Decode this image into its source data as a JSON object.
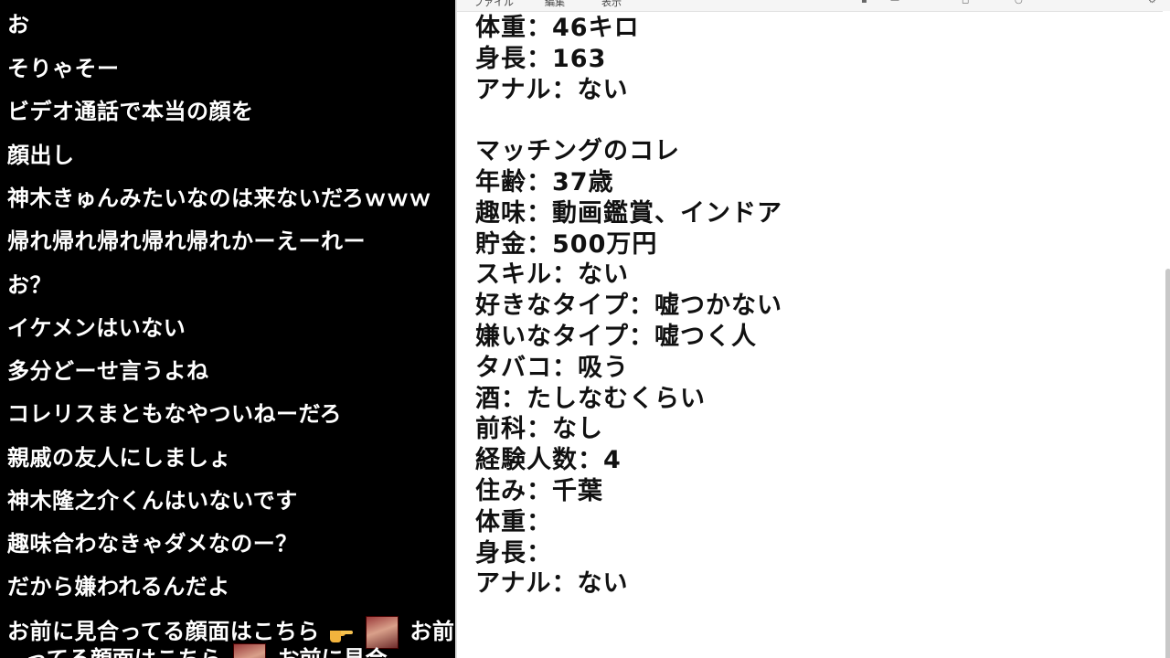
{
  "chat": {
    "messages": [
      "お",
      "そりゃそー",
      "ビデオ通話で本当の顔を",
      "顔出し",
      "神木きゅんみたいなのは来ないだろｗｗｗ",
      "帰れ帰れ帰れ帰れ帰れかーえーれー",
      "お？",
      "イケメンはいない",
      "多分どーせ言うよね",
      "コレリスまともなやついねーだろ",
      "親戚の友人にしましょ",
      "神木隆之介くんはいないです",
      "趣味合わなきゃダメなのー？",
      "だから嫌われるんだよ"
    ],
    "last_message_part1": "お前に見合ってる顔面はこちら",
    "last_message_part2": "お前に",
    "overflow_line": "ってる顔面はこちら",
    "overflow_line_tail": "お前に見合",
    "hand_icon": "pointing-hand-emoji",
    "face_icon": "face-image"
  },
  "notepad": {
    "menu": [
      "ファイル",
      "編集",
      "表示"
    ],
    "lines": [
      "体重：46キロ",
      "身長：163",
      "アナル：ない",
      "",
      "マッチングのコレ",
      "年齢：37歳",
      "趣味：動画鑑賞、インドア",
      "貯金：500万円",
      "スキル：ない",
      "好きなタイプ：嘘つかない",
      "嫌いなタイプ：嘘つく人",
      "タバコ：吸う",
      "酒：たしなむくらい",
      "前科：なし",
      "経験人数：4",
      "住み：千葉",
      "体重：",
      "身長：",
      "アナル：ない"
    ]
  }
}
